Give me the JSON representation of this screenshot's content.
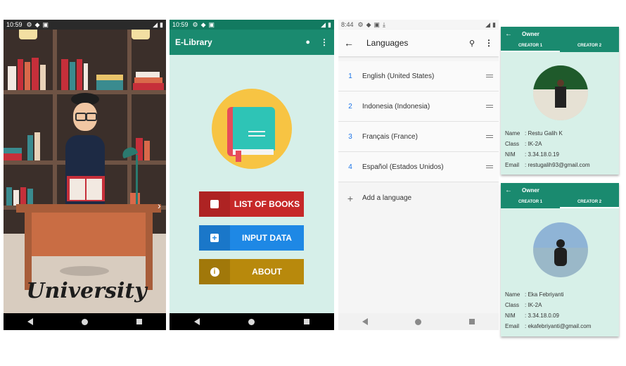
{
  "panel1": {
    "status_time": "10:59",
    "logo_text": "University"
  },
  "panel2": {
    "status_time": "10:59",
    "app_title": "E-Library",
    "buttons": [
      {
        "label": "LIST OF BOOKS",
        "color": "#c62828"
      },
      {
        "label": "INPUT DATA",
        "color": "#1e88e5"
      },
      {
        "label": "ABOUT",
        "color": "#b8890c"
      }
    ]
  },
  "panel3": {
    "status_time": "8:44",
    "title": "Languages",
    "languages": [
      {
        "num": "1",
        "name": "English (United States)"
      },
      {
        "num": "2",
        "name": "Indonesia (Indonesia)"
      },
      {
        "num": "3",
        "name": "Français (France)"
      },
      {
        "num": "4",
        "name": "Español (Estados Unidos)"
      }
    ],
    "add_label": "Add a language"
  },
  "owner_top": {
    "title": "Owner",
    "tab1": "CREATOR 1",
    "tab2": "CREATOR 2",
    "fields": [
      {
        "k": "Name",
        "v": ": Restu Galih K"
      },
      {
        "k": "Class",
        "v": ": IK-2A"
      },
      {
        "k": "NIM",
        "v": ": 3.34.18.0.19"
      },
      {
        "k": "Email",
        "v": ": restugalih93@gmail.com"
      }
    ]
  },
  "owner_bottom": {
    "title": "Owner",
    "tab1": "CREATOR 1",
    "tab2": "CREATOR 2",
    "fields": [
      {
        "k": "Name",
        "v": ": Eka Febriyanti"
      },
      {
        "k": "Class",
        "v": ": IK-2A"
      },
      {
        "k": "NIM",
        "v": ": 3.34.18.0.09"
      },
      {
        "k": "Email",
        "v": ": ekafebriyanti@gmail.com"
      }
    ]
  },
  "colors": {
    "primary": "#1a8a6f",
    "background": "#d6efe9"
  }
}
